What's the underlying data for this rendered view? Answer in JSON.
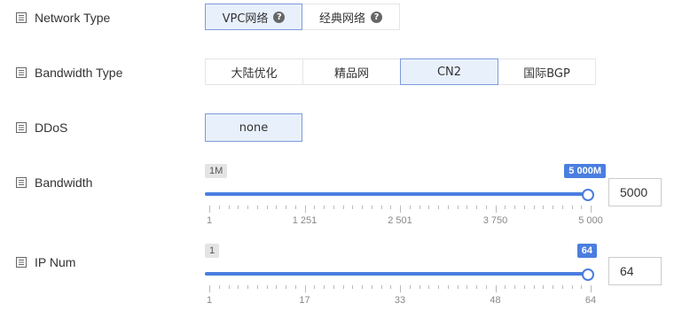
{
  "network_type": {
    "label": "Network Type",
    "options": [
      {
        "label": "VPC网络",
        "has_help": true,
        "selected": true
      },
      {
        "label": "经典网络",
        "has_help": true,
        "selected": false
      }
    ]
  },
  "bandwidth_type": {
    "label": "Bandwidth Type",
    "options": [
      {
        "label": "大陆优化",
        "selected": false
      },
      {
        "label": "精品网",
        "selected": false
      },
      {
        "label": "CN2",
        "selected": true
      },
      {
        "label": "国际BGP",
        "selected": false
      }
    ]
  },
  "ddos": {
    "label": "DDoS",
    "options": [
      {
        "label": "none",
        "selected": true
      }
    ]
  },
  "bandwidth": {
    "label": "Bandwidth",
    "min_badge": "1M",
    "max_badge": "5 000M",
    "min": 1,
    "max": 5000,
    "value": 5000,
    "input_value": "5000",
    "tick_labels": [
      "1",
      "1 251",
      "2 501",
      "3 750",
      "5 000"
    ]
  },
  "ip_num": {
    "label": "IP Num",
    "min_badge": "1",
    "max_badge": "64",
    "min": 1,
    "max": 64,
    "value": 64,
    "input_value": "64",
    "tick_labels": [
      "1",
      "17",
      "33",
      "48",
      "64"
    ]
  },
  "colors": {
    "accent": "#4a7ee0",
    "selected_bg": "#e8f0fc",
    "selected_border": "#7d9bd9"
  }
}
